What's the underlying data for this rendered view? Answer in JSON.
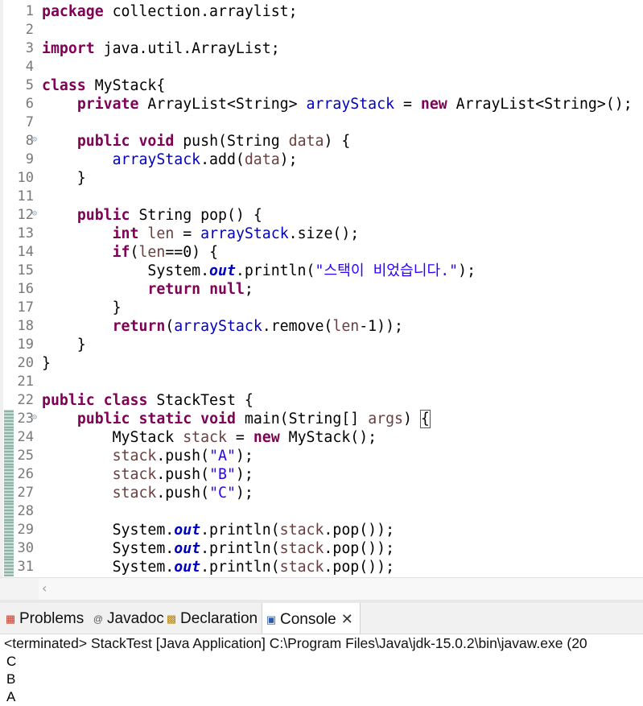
{
  "editor": {
    "lines": [
      {
        "n": "1",
        "tokens": [
          {
            "t": "package",
            "c": "kw"
          },
          {
            "t": " collection.arraylist;",
            "c": ""
          }
        ]
      },
      {
        "n": "2",
        "tokens": []
      },
      {
        "n": "3",
        "tokens": [
          {
            "t": "import",
            "c": "kw"
          },
          {
            "t": " java.util.ArrayList;",
            "c": ""
          }
        ]
      },
      {
        "n": "4",
        "tokens": []
      },
      {
        "n": "5",
        "tokens": [
          {
            "t": "class",
            "c": "kw"
          },
          {
            "t": " MyStack{",
            "c": ""
          }
        ]
      },
      {
        "n": "6",
        "tokens": [
          {
            "t": "    ",
            "c": ""
          },
          {
            "t": "private",
            "c": "kw"
          },
          {
            "t": " ArrayList<String> ",
            "c": ""
          },
          {
            "t": "arrayStack",
            "c": "fld"
          },
          {
            "t": " = ",
            "c": ""
          },
          {
            "t": "new",
            "c": "kw"
          },
          {
            "t": " ArrayList<String>();",
            "c": ""
          }
        ]
      },
      {
        "n": "7",
        "tokens": []
      },
      {
        "n": "8",
        "fold": true,
        "tokens": [
          {
            "t": "    ",
            "c": ""
          },
          {
            "t": "public",
            "c": "kw"
          },
          {
            "t": " ",
            "c": ""
          },
          {
            "t": "void",
            "c": "kw"
          },
          {
            "t": " push(String ",
            "c": ""
          },
          {
            "t": "data",
            "c": "prm"
          },
          {
            "t": ") {",
            "c": ""
          }
        ]
      },
      {
        "n": "9",
        "tokens": [
          {
            "t": "        ",
            "c": ""
          },
          {
            "t": "arrayStack",
            "c": "fld"
          },
          {
            "t": ".add(",
            "c": ""
          },
          {
            "t": "data",
            "c": "prm"
          },
          {
            "t": ");",
            "c": ""
          }
        ]
      },
      {
        "n": "10",
        "tokens": [
          {
            "t": "    }",
            "c": ""
          }
        ]
      },
      {
        "n": "11",
        "tokens": []
      },
      {
        "n": "12",
        "fold": true,
        "tokens": [
          {
            "t": "    ",
            "c": ""
          },
          {
            "t": "public",
            "c": "kw"
          },
          {
            "t": " String pop() {",
            "c": ""
          }
        ]
      },
      {
        "n": "13",
        "tokens": [
          {
            "t": "        ",
            "c": ""
          },
          {
            "t": "int",
            "c": "kw"
          },
          {
            "t": " ",
            "c": ""
          },
          {
            "t": "len",
            "c": "prm"
          },
          {
            "t": " = ",
            "c": ""
          },
          {
            "t": "arrayStack",
            "c": "fld"
          },
          {
            "t": ".size();",
            "c": ""
          }
        ]
      },
      {
        "n": "14",
        "tokens": [
          {
            "t": "        ",
            "c": ""
          },
          {
            "t": "if",
            "c": "kw"
          },
          {
            "t": "(",
            "c": ""
          },
          {
            "t": "len",
            "c": "prm"
          },
          {
            "t": "==0) {",
            "c": ""
          }
        ]
      },
      {
        "n": "15",
        "tokens": [
          {
            "t": "            System.",
            "c": ""
          },
          {
            "t": "out",
            "c": "st"
          },
          {
            "t": ".println(",
            "c": ""
          },
          {
            "t": "\"스택이 비었습니다.\"",
            "c": "str"
          },
          {
            "t": ");",
            "c": ""
          }
        ]
      },
      {
        "n": "16",
        "tokens": [
          {
            "t": "            ",
            "c": ""
          },
          {
            "t": "return",
            "c": "kw"
          },
          {
            "t": " ",
            "c": ""
          },
          {
            "t": "null",
            "c": "kw"
          },
          {
            "t": ";",
            "c": ""
          }
        ]
      },
      {
        "n": "17",
        "tokens": [
          {
            "t": "        }",
            "c": ""
          }
        ]
      },
      {
        "n": "18",
        "tokens": [
          {
            "t": "        ",
            "c": ""
          },
          {
            "t": "return",
            "c": "kw"
          },
          {
            "t": "(",
            "c": ""
          },
          {
            "t": "arrayStack",
            "c": "fld"
          },
          {
            "t": ".remove(",
            "c": ""
          },
          {
            "t": "len",
            "c": "prm"
          },
          {
            "t": "-1));",
            "c": ""
          }
        ]
      },
      {
        "n": "19",
        "tokens": [
          {
            "t": "    }",
            "c": ""
          }
        ]
      },
      {
        "n": "20",
        "tokens": [
          {
            "t": "}",
            "c": ""
          }
        ]
      },
      {
        "n": "21",
        "tokens": []
      },
      {
        "n": "22",
        "tokens": [
          {
            "t": "public",
            "c": "kw"
          },
          {
            "t": " ",
            "c": ""
          },
          {
            "t": "class",
            "c": "kw"
          },
          {
            "t": " StackTest {",
            "c": ""
          }
        ]
      },
      {
        "n": "23",
        "fold": true,
        "marker": true,
        "tokens": [
          {
            "t": "    ",
            "c": ""
          },
          {
            "t": "public",
            "c": "kw"
          },
          {
            "t": " ",
            "c": ""
          },
          {
            "t": "static",
            "c": "kw"
          },
          {
            "t": " ",
            "c": ""
          },
          {
            "t": "void",
            "c": "kw"
          },
          {
            "t": " main(String[] ",
            "c": ""
          },
          {
            "t": "args",
            "c": "prm"
          },
          {
            "t": ") ",
            "c": ""
          },
          {
            "t": "{",
            "c": "br"
          }
        ]
      },
      {
        "n": "24",
        "marker": true,
        "tokens": [
          {
            "t": "        MyStack ",
            "c": ""
          },
          {
            "t": "stack",
            "c": "prm"
          },
          {
            "t": " = ",
            "c": ""
          },
          {
            "t": "new",
            "c": "kw"
          },
          {
            "t": " MyStack();",
            "c": ""
          }
        ]
      },
      {
        "n": "25",
        "marker": true,
        "tokens": [
          {
            "t": "        ",
            "c": ""
          },
          {
            "t": "stack",
            "c": "prm"
          },
          {
            "t": ".push(",
            "c": ""
          },
          {
            "t": "\"A\"",
            "c": "str"
          },
          {
            "t": ");",
            "c": ""
          }
        ]
      },
      {
        "n": "26",
        "marker": true,
        "tokens": [
          {
            "t": "        ",
            "c": ""
          },
          {
            "t": "stack",
            "c": "prm"
          },
          {
            "t": ".push(",
            "c": ""
          },
          {
            "t": "\"B\"",
            "c": "str"
          },
          {
            "t": ");",
            "c": ""
          }
        ]
      },
      {
        "n": "27",
        "marker": true,
        "tokens": [
          {
            "t": "        ",
            "c": ""
          },
          {
            "t": "stack",
            "c": "prm"
          },
          {
            "t": ".push(",
            "c": ""
          },
          {
            "t": "\"C\"",
            "c": "str"
          },
          {
            "t": ");",
            "c": ""
          }
        ]
      },
      {
        "n": "28",
        "marker": true,
        "tokens": []
      },
      {
        "n": "29",
        "marker": true,
        "tokens": [
          {
            "t": "        System.",
            "c": ""
          },
          {
            "t": "out",
            "c": "st"
          },
          {
            "t": ".println(",
            "c": ""
          },
          {
            "t": "stack",
            "c": "prm"
          },
          {
            "t": ".pop());",
            "c": ""
          }
        ]
      },
      {
        "n": "30",
        "marker": true,
        "tokens": [
          {
            "t": "        System.",
            "c": ""
          },
          {
            "t": "out",
            "c": "st"
          },
          {
            "t": ".println(",
            "c": ""
          },
          {
            "t": "stack",
            "c": "prm"
          },
          {
            "t": ".pop());",
            "c": ""
          }
        ]
      },
      {
        "n": "31",
        "marker": true,
        "tokens": [
          {
            "t": "        System.",
            "c": ""
          },
          {
            "t": "out",
            "c": "st"
          },
          {
            "t": ".println(",
            "c": ""
          },
          {
            "t": "stack",
            "c": "prm"
          },
          {
            "t": ".pop());",
            "c": ""
          }
        ]
      }
    ],
    "fold_icon": "collapse-icon",
    "scroll_left_icon": "chevron-left-icon"
  },
  "panel": {
    "tabs": [
      {
        "label": "Problems",
        "icon": "problems-icon",
        "active": false
      },
      {
        "label": "Javadoc",
        "icon": "at-icon",
        "active": false
      },
      {
        "label": "Declaration",
        "icon": "declaration-icon",
        "active": false
      },
      {
        "label": "Console",
        "icon": "console-icon",
        "active": true
      }
    ],
    "close_icon": "close-icon"
  },
  "console": {
    "status": "<terminated> StackTest [Java Application] C:\\Program Files\\Java\\jdk-15.0.2\\bin\\javaw.exe  (20",
    "output": [
      "C",
      "B",
      "A"
    ]
  },
  "colors": {
    "keyword": "#7f0055",
    "field": "#0000c0",
    "string": "#2a00ff",
    "param": "#6a3e3e"
  }
}
